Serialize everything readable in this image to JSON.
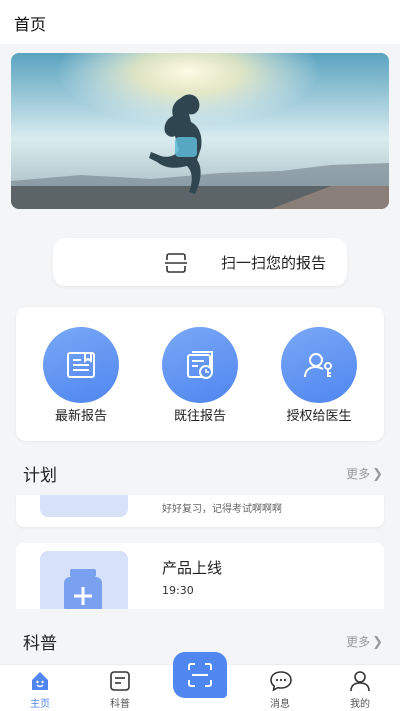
{
  "header": {
    "title": "首页"
  },
  "banner": {
    "icon": "runner-sunset-image"
  },
  "scan": {
    "label": "扫一扫您的报告",
    "icon": "scan-icon"
  },
  "quick_actions": [
    {
      "label": "最新报告",
      "icon": "report-icon"
    },
    {
      "label": "既往报告",
      "icon": "history-report-icon"
    },
    {
      "label": "授权给医生",
      "icon": "authorize-doctor-icon"
    }
  ],
  "plan": {
    "title": "计划",
    "more": "更多",
    "items": [
      {
        "note": "好好复习，记得考试啊啊啊"
      },
      {
        "title": "产品上线",
        "time": "19:30"
      }
    ]
  },
  "science": {
    "title": "科普",
    "more": "更多"
  },
  "bottom_nav": [
    {
      "label": "主页",
      "icon": "home-icon",
      "active": true
    },
    {
      "label": "科普",
      "icon": "article-icon",
      "active": false
    },
    {
      "label": "",
      "icon": "scan-icon",
      "active": false
    },
    {
      "label": "消息",
      "icon": "message-icon",
      "active": false
    },
    {
      "label": "我的",
      "icon": "profile-icon",
      "active": false
    }
  ],
  "colors": {
    "accent": "#4f86f0",
    "background": "#f4f5f7"
  }
}
